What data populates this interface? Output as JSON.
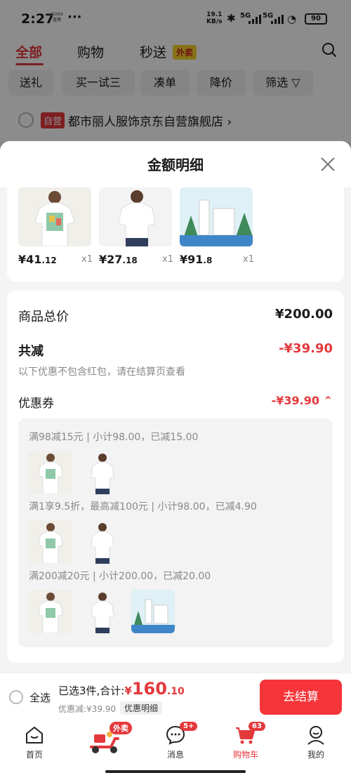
{
  "status_bar": {
    "time": "2:27",
    "boss_badge": "BOSS直聘",
    "more": "···",
    "speed_value": "19.1",
    "speed_unit": "KB/s",
    "net1": "5G",
    "net2": "5G",
    "battery": "90"
  },
  "tabs": {
    "all": "全部",
    "shopping": "购物",
    "express": "秒送",
    "express_tag": "外卖"
  },
  "filters": [
    "送礼",
    "买一试三",
    "凑单",
    "降价",
    "筛选 ▽"
  ],
  "store": {
    "self_tag": "自营",
    "name": "都市丽人服饰京东自营旗舰店",
    "chevron": "›"
  },
  "sheet": {
    "title": "金额明细",
    "products": [
      {
        "price_int": "¥41",
        "price_dec": ".12",
        "qty": "x1"
      },
      {
        "price_int": "¥27",
        "price_dec": ".18",
        "qty": "x1"
      },
      {
        "price_int": "¥91",
        "price_dec": ".8",
        "qty": "x1"
      }
    ],
    "summary": {
      "total_label": "商品总价",
      "total_value": "¥200.00",
      "discount_label": "共减",
      "discount_value": "-¥39.90",
      "note": "以下优惠不包含红包，请在结算页查看",
      "coupon_label": "优惠券",
      "coupon_value": "-¥39.90 ⌃",
      "rules": [
        "满98减15元 | 小计98.00，已减15.00",
        "满1享9.5折，最高减100元 | 小计98.00，已减4.90",
        "满200减20元 | 小计200.00，已减20.00"
      ]
    }
  },
  "checkout": {
    "select_all": "全选",
    "selected_text": "已选3件,合计:",
    "currency": "¥",
    "total_int": "160",
    "total_dec": ".10",
    "discount_text": "优惠减:¥39.90",
    "detail_button": "优惠明细",
    "checkout_button": "去结算"
  },
  "bottom_nav": {
    "home": "首页",
    "waimai_badge": "外卖",
    "messages": "消息",
    "messages_badge": "5+",
    "cart": "购物车",
    "cart_badge": "63",
    "mine": "我的"
  },
  "colors": {
    "accent": "#e4393c",
    "checkout": "#f5353a"
  }
}
